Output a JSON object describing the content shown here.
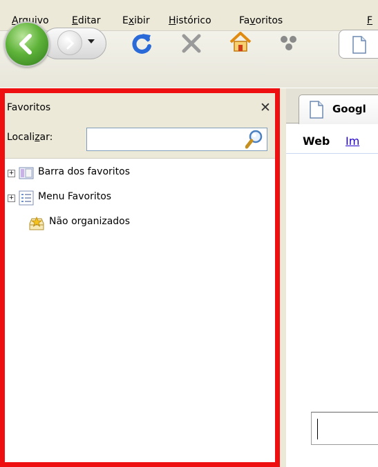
{
  "menu": {
    "items": [
      {
        "label": "Arquivo",
        "accel_index": 0
      },
      {
        "label": "Editar",
        "accel_index": 0
      },
      {
        "label": "Exibir",
        "accel_index": 1
      },
      {
        "label": "Histórico",
        "accel_index": 0
      },
      {
        "label": "Favoritos",
        "accel_index": 2
      },
      {
        "label": "F",
        "accel_index": 0
      }
    ]
  },
  "toolbar": {
    "icons": [
      "back-arrow-icon",
      "forward-arrow-icon",
      "history-dropdown-icon",
      "reload-icon",
      "stop-icon",
      "home-icon",
      "extension-icon",
      "page-icon"
    ],
    "accent_colors": {
      "back": "#3f9a22",
      "reload": "#2a6ad8",
      "home": "#f0a020"
    }
  },
  "sidebar": {
    "title": "Favoritos",
    "close_glyph": "✕",
    "search_label_prefix": "Locali",
    "search_label_accel": "z",
    "search_label_suffix": "ar:",
    "search_value": "",
    "items": [
      {
        "label": "Barra dos favoritos",
        "expander": "+",
        "icon": "bookmarks-toolbar-icon"
      },
      {
        "label": "Menu Favoritos",
        "expander": "+",
        "icon": "bookmarks-menu-icon"
      },
      {
        "label": "Não organizados",
        "expander": "",
        "icon": "unsorted-bookmarks-icon"
      }
    ],
    "highlight_color": "#ee1010"
  },
  "content": {
    "tab_label": "Googl",
    "nav": {
      "web": "Web",
      "images": "Im"
    },
    "search_value": ""
  }
}
